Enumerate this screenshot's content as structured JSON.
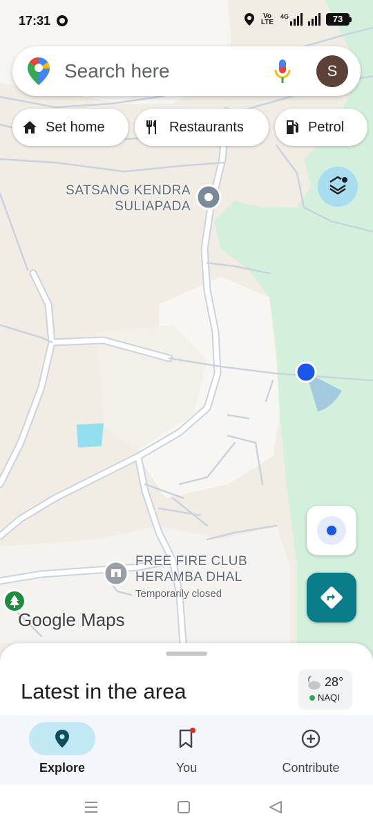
{
  "status_bar": {
    "time": "17:31",
    "network_label": "Vo LTE",
    "network_type": "4G",
    "battery": "73"
  },
  "search": {
    "placeholder": "Search here",
    "avatar_initial": "S"
  },
  "chips": [
    {
      "label": "Set home",
      "icon": "home-icon"
    },
    {
      "label": "Restaurants",
      "icon": "restaurant-icon"
    },
    {
      "label": "Petrol",
      "icon": "gas-station-icon"
    }
  ],
  "map": {
    "places": [
      {
        "name_line1": "SATSANG KENDRA",
        "name_line2": "SULIAPADA"
      },
      {
        "name_line1": "FREE FIRE CLUB",
        "name_line2": "HERAMBA DHAL",
        "status": "Temporarily closed"
      }
    ],
    "logo": "Google Maps",
    "colors": {
      "land": "#f1ece4",
      "forest": "#d2f0dc",
      "road": "#ffffff",
      "road_outline": "#c9d3df",
      "location_dot": "#1a56e8",
      "water": "#92dff0"
    }
  },
  "bottom_sheet": {
    "title": "Latest in the area",
    "weather": {
      "temp": "28°",
      "aqi": "NAQI"
    }
  },
  "bottom_nav": [
    {
      "label": "Explore",
      "icon": "explore-pin-icon",
      "active": true
    },
    {
      "label": "You",
      "icon": "bookmark-icon",
      "active": false
    },
    {
      "label": "Contribute",
      "icon": "add-circle-icon",
      "active": false
    }
  ],
  "accent": "#0b7d8a"
}
